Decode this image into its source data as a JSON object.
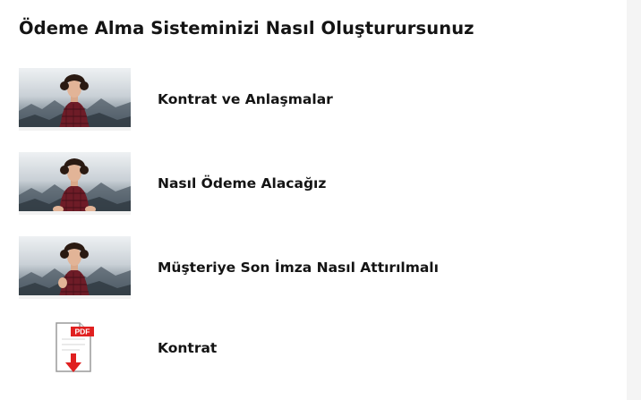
{
  "section": {
    "title": "Ödeme Alma Sisteminizi Nasıl Oluşturursunuz"
  },
  "lessons": [
    {
      "label": "Kontrat ve Anlaşmalar",
      "thumbnail": "video-thumbnail"
    },
    {
      "label": "Nasıl Ödeme Alacağız",
      "thumbnail": "video-thumbnail"
    },
    {
      "label": "Müşteriye Son İmza Nasıl Attırılmalı",
      "thumbnail": "video-thumbnail"
    },
    {
      "label": "Kontrat",
      "thumbnail": "pdf-download-icon",
      "badge": "PDF"
    }
  ],
  "colors": {
    "pdf_red": "#e02020",
    "shirt": "#7a1f2a",
    "text": "#141414"
  }
}
